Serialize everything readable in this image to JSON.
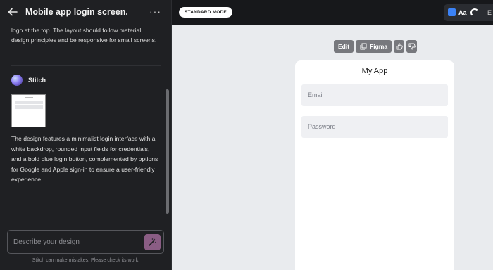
{
  "chat": {
    "title": "Mobile app login screen.",
    "more_label": "···",
    "prompt_text": "logo at the top. The layout should follow material design principles and be responsive for small screens.",
    "agent_name": "Stitch",
    "response_text": "The design features a minimalist login interface with a white backdrop, rounded input fields for credentials, and a bold blue login button, complemented by options for Google and Apple sign-in to ensure a user-friendly experience.",
    "input_placeholder": "Describe your design",
    "disclaimer": "Stitch can make mistakes. Please check its work."
  },
  "topbar": {
    "mode_label": "STANDARD MODE",
    "aa_label": "Aa",
    "edge_label": "E",
    "accent_color": "#3b82f6"
  },
  "canvas_toolbar": {
    "edit_label": "Edit",
    "figma_label": "Figma",
    "like_icon": "thumbs-up-icon",
    "dislike_icon": "thumbs-down-icon"
  },
  "preview": {
    "app_title": "My App",
    "email_placeholder": "Email",
    "password_placeholder": "Password"
  }
}
